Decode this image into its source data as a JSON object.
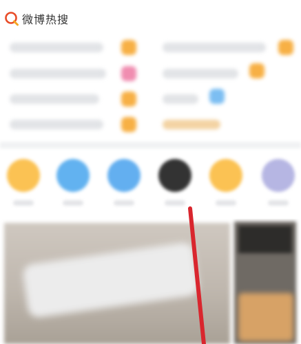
{
  "header": {
    "title": "微博热搜",
    "logo_icon": "search-logo-icon",
    "logo_color": "#e84b27"
  },
  "hot_search_panel": {
    "left_rows": 4,
    "right_rows": 4,
    "tag_colors": {
      "hot": "#f7b045",
      "new": "#f08db0",
      "trend": "#7cbef2"
    }
  },
  "quick_entries": {
    "icon_colors": [
      "#fbc253",
      "#62b2f0",
      "#63aff0",
      "#333333",
      "#fbc253",
      "#b6b6e3"
    ]
  },
  "annotation": {
    "color": "#d9262e",
    "shape": "red-line"
  }
}
